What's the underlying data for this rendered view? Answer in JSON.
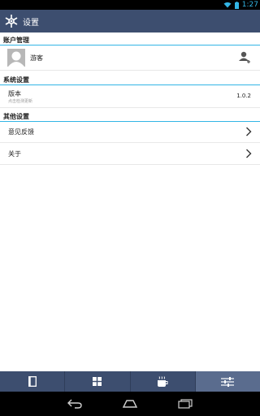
{
  "status_bar": {
    "time": "1:27"
  },
  "app_bar": {
    "title": "设置",
    "icon": "snowflake-icon"
  },
  "sections": {
    "account": {
      "header": "账户管理",
      "user_name": "游客",
      "action_icon": "add-user-icon"
    },
    "system": {
      "header": "系统设置",
      "version_label": "版本",
      "version_hint": "点击检测更新",
      "version_value": "1.0.2"
    },
    "other": {
      "header": "其他设置",
      "feedback_label": "意见反馈",
      "about_label": "关于"
    }
  },
  "bottom_nav": {
    "tabs": [
      {
        "icon": "document-icon",
        "active": false
      },
      {
        "icon": "grid-icon",
        "active": false
      },
      {
        "icon": "coffee-icon",
        "active": false
      },
      {
        "icon": "settings-sliders-icon",
        "active": true
      }
    ]
  },
  "system_nav": {
    "buttons": [
      "back-icon",
      "home-icon",
      "recents-icon"
    ]
  },
  "colors": {
    "primary": "#3d4e6f",
    "accent": "#33b5e5",
    "active_tab": "#5a6c8e"
  }
}
